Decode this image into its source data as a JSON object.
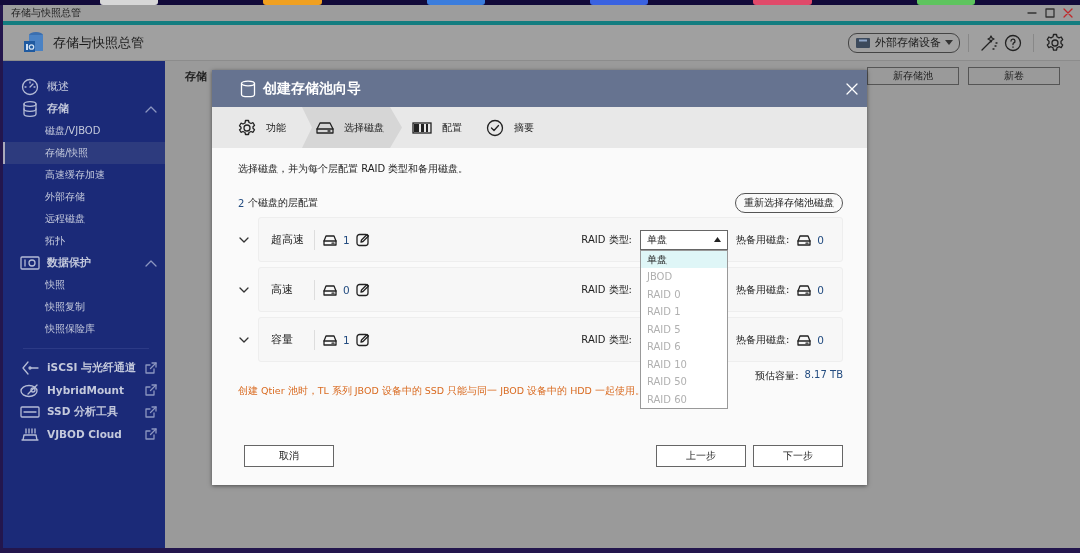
{
  "window": {
    "title": "存储与快照总管"
  },
  "app": {
    "title": "存储与快照总管",
    "device_selector": "外部存储设备"
  },
  "sidebar": {
    "items": [
      {
        "label": "概述",
        "kind": "page"
      },
      {
        "label": "存储",
        "kind": "group",
        "expanded": true,
        "children": [
          {
            "label": "磁盘/VJBOD",
            "selected": false
          },
          {
            "label": "存储/快照",
            "selected": true
          },
          {
            "label": "高速缓存加速",
            "selected": false
          },
          {
            "label": "外部存储",
            "selected": false
          },
          {
            "label": "远程磁盘",
            "selected": false
          },
          {
            "label": "拓扑",
            "selected": false
          }
        ]
      },
      {
        "label": "数据保护",
        "kind": "group",
        "expanded": true,
        "children": [
          {
            "label": "快照",
            "selected": false
          },
          {
            "label": "快照复制",
            "selected": false
          },
          {
            "label": "快照保险库",
            "selected": false
          }
        ]
      },
      {
        "label": "iSCSI 与光纤通道",
        "kind": "external"
      },
      {
        "label": "HybridMount",
        "kind": "external"
      },
      {
        "label": "SSD 分析工具",
        "kind": "external"
      },
      {
        "label": "VJBOD Cloud",
        "kind": "external"
      }
    ]
  },
  "main": {
    "section_title": "存储",
    "buttons": [
      "新存储池",
      "新卷"
    ]
  },
  "dialog": {
    "title": "创建存储池向导",
    "steps": [
      {
        "label": "功能",
        "selected": false
      },
      {
        "label": "选择磁盘",
        "selected": true
      },
      {
        "label": "配置",
        "selected": false
      },
      {
        "label": "摘要",
        "selected": false
      }
    ],
    "intro": "选择磁盘，并为每个层配置 RAID 类型和备用磁盘。",
    "tier_count": "2",
    "tier_caption": "个磁盘的层配置",
    "reselect_button": "重新选择存储池磁盘",
    "tiers": [
      {
        "name": "超高速",
        "expanded": false,
        "disks": "1",
        "raid_label": "RAID 类型:",
        "raid_value": "单盘",
        "open": true,
        "spare_label": "热备用磁盘:",
        "spares": "0"
      },
      {
        "name": "高速",
        "expanded": false,
        "disks": "0",
        "raid_label": "RAID 类型:",
        "spare_label": "热备用磁盘:",
        "spares": "0"
      },
      {
        "name": "容量",
        "expanded": false,
        "disks": "1",
        "raid_label": "RAID 类型:",
        "spare_label": "热备用磁盘:",
        "spares": "0"
      }
    ],
    "raid_options": [
      {
        "label": "单盘",
        "selected": true,
        "disabled": false
      },
      {
        "label": "JBOD",
        "selected": false,
        "disabled": true
      },
      {
        "label": "RAID 0",
        "selected": false,
        "disabled": true
      },
      {
        "label": "RAID 1",
        "selected": false,
        "disabled": true
      },
      {
        "label": "RAID 5",
        "selected": false,
        "disabled": true
      },
      {
        "label": "RAID 6",
        "selected": false,
        "disabled": true
      },
      {
        "label": "RAID 10",
        "selected": false,
        "disabled": true
      },
      {
        "label": "RAID 50",
        "selected": false,
        "disabled": true
      },
      {
        "label": "RAID 60",
        "selected": false,
        "disabled": true
      }
    ],
    "estimate_label": "预估容量:",
    "estimate": "8.17 TB",
    "warning": "创建 Qtier 池时，TL 系列 JBOD 设备中的 SSD 只能与同一 JBOD 设备中的 HDD 一起使用。",
    "buttons": {
      "cancel": "取消",
      "back": "上一步",
      "next": "下一步"
    }
  }
}
